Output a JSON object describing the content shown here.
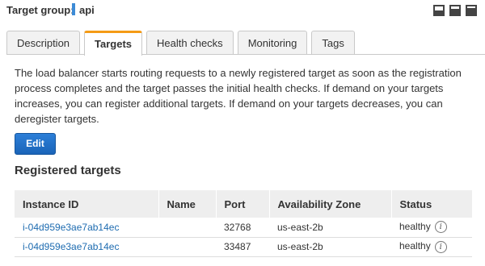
{
  "header": {
    "target_group_label": "Target group:",
    "target_group_name": "api"
  },
  "layout_controls": [
    "layout-bottom-icon",
    "layout-split-icon",
    "layout-top-icon"
  ],
  "tabs": [
    {
      "label": "Description",
      "active": false
    },
    {
      "label": "Targets",
      "active": true
    },
    {
      "label": "Health checks",
      "active": false
    },
    {
      "label": "Monitoring",
      "active": false
    },
    {
      "label": "Tags",
      "active": false
    }
  ],
  "main": {
    "description": "The load balancer starts routing requests to a newly registered target as soon as the registration process completes and the target passes the initial health checks. If demand on your targets increases, you can register additional targets. If demand on your targets decreases, you can deregister targets.",
    "edit_label": "Edit",
    "section_title": "Registered targets"
  },
  "table": {
    "columns": [
      "Instance ID",
      "Name",
      "Port",
      "Availability Zone",
      "Status"
    ],
    "rows": [
      {
        "instance_id": "i-04d959e3ae7ab14ec",
        "name": "",
        "port": "32768",
        "zone": "us-east-2b",
        "status": "healthy"
      },
      {
        "instance_id": "i-04d959e3ae7ab14ec",
        "name": "",
        "port": "33487",
        "zone": "us-east-2b",
        "status": "healthy"
      }
    ]
  },
  "colors": {
    "accent_tab": "#f59b16",
    "primary_button": "#1a64b8",
    "link": "#1d6bb0",
    "name_bar": "#3d8bd6"
  }
}
